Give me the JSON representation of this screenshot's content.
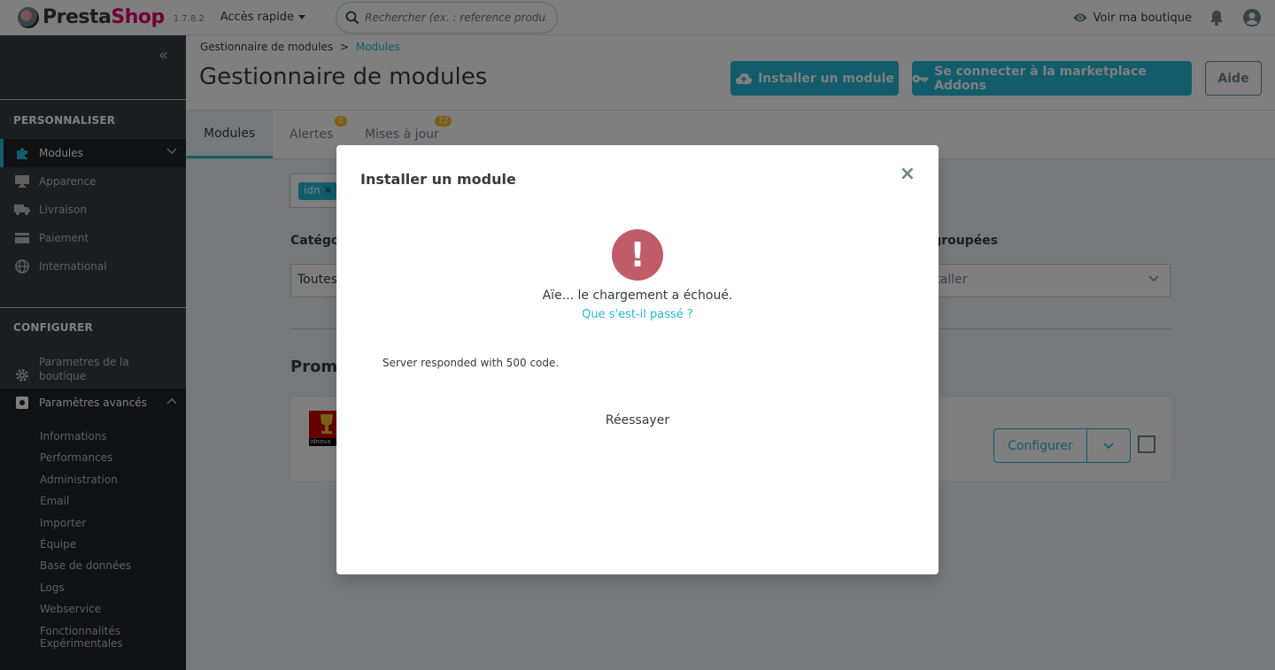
{
  "header": {
    "logo_text_presta": "Presta",
    "logo_text_shop": "Shop",
    "version": "1.7.8.2",
    "quick_access": "Accès rapide",
    "search_placeholder": "Rechercher (ex. : reference produit, no",
    "view_shop": "Voir ma boutique"
  },
  "sidebar": {
    "collapse": "«",
    "section_customize": "PERSONNALISER",
    "customize_items": [
      "Modules",
      "Apparence",
      "Livraison",
      "Paiement",
      "International"
    ],
    "section_configure": "CONFIGURER",
    "shop_params_line1": "Parametres de la",
    "shop_params_line2": "boutique",
    "advanced_params": "Paramètres avancés",
    "sub_items": [
      "Informations",
      "Performances",
      "Administration",
      "Email",
      "Importer",
      "Équipe",
      "Base de données",
      "Logs",
      "Webservice"
    ],
    "experimental_line1": "Fonctionnalités",
    "experimental_line2": "Expérimentales"
  },
  "page": {
    "breadcrumb_parent": "Gestionnaire de modules",
    "breadcrumb_sep": ">",
    "breadcrumb_current": "Modules",
    "title": "Gestionnaire de modules",
    "btn_install": "Installer un module",
    "btn_marketplace": "Se connecter à la marketplace Addons",
    "btn_help": "Aide"
  },
  "tabs": [
    {
      "label": "Modules",
      "badge": ""
    },
    {
      "label": "Alertes",
      "badge": "0"
    },
    {
      "label": "Mises à jour",
      "badge": "12"
    }
  ],
  "content": {
    "filter_tag": "idn",
    "category_label": "Catégor",
    "category_value": "Toutes",
    "bulk_label": "s groupées",
    "bulk_value": "staller",
    "promo_title": "Promo",
    "module_logo_text": "idnova",
    "configure_button": "Configurer"
  },
  "modal": {
    "title": "Installer un module",
    "close": "×",
    "icon": "!",
    "error_text": "Aïe... le chargement a échoué.",
    "error_link": "Que s'est-il passé ?",
    "error_detail": "Server responded with 500 code.",
    "retry": "Réessayer"
  },
  "colors": {
    "accent": "#25b9d7",
    "sidebar": "#363a41",
    "error": "#c05c67",
    "badge": "#fbbb22"
  }
}
